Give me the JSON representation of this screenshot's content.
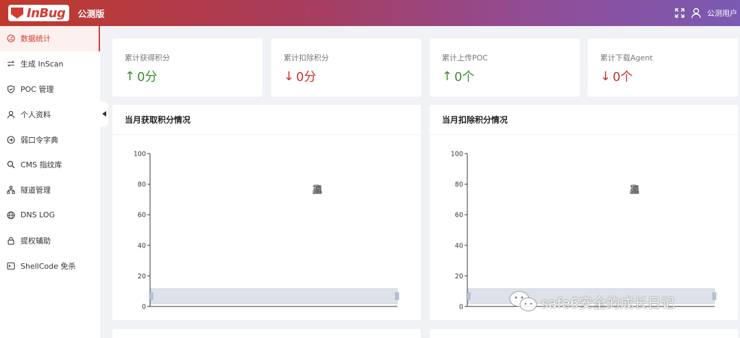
{
  "header": {
    "logo_text": "InBug",
    "edition": "公测版",
    "user_name": "公测用户",
    "icons": [
      "fullscreen-icon",
      "user-icon"
    ]
  },
  "sidebar": {
    "items": [
      {
        "label": "数据统计",
        "icon": "dashboard-icon",
        "active": true
      },
      {
        "label": "生成 InScan",
        "icon": "swap-icon"
      },
      {
        "label": "POC 管理",
        "icon": "shield-icon"
      },
      {
        "label": "个人资料",
        "icon": "user-icon"
      },
      {
        "label": "弱口令字典",
        "icon": "login-icon"
      },
      {
        "label": "CMS 指纹库",
        "icon": "search-icon"
      },
      {
        "label": "隧道管理",
        "icon": "tree-icon"
      },
      {
        "label": "DNS LOG",
        "icon": "globe-icon"
      },
      {
        "label": "提权辅助",
        "icon": "lock-icon"
      },
      {
        "label": "ShellCode 免杀",
        "icon": "terminal-icon"
      }
    ]
  },
  "stats": [
    {
      "label": "累计获得积分",
      "arrow": "↑",
      "value": "0分",
      "direction": "up"
    },
    {
      "label": "累计扣除积分",
      "arrow": "↓",
      "value": "0分",
      "direction": "down"
    },
    {
      "label": "累计上传POC",
      "arrow": "↑",
      "value": "0个",
      "direction": "up"
    },
    {
      "label": "累计下载Agent",
      "arrow": "↓",
      "value": "0个",
      "direction": "down"
    }
  ],
  "panels": [
    {
      "title": "当月获取积分情况"
    },
    {
      "title": "当月扣除积分情况"
    }
  ],
  "chart_data": [
    {
      "type": "bar",
      "title": "",
      "categories": [],
      "series": [],
      "ylim": [
        0,
        100
      ],
      "yticks": [
        "100",
        "80",
        "60",
        "40",
        "20",
        "0"
      ],
      "grid": false,
      "toolbox": [
        "data-view-icon",
        "restore-icon",
        "zoom-icon",
        "zoom-reset-icon",
        "download-icon",
        "bar-switch-icon",
        "line-switch-icon"
      ],
      "datazoom": true
    },
    {
      "type": "bar",
      "title": "",
      "categories": [],
      "series": [],
      "ylim": [
        0,
        100
      ],
      "yticks": [
        "100",
        "80",
        "60",
        "40",
        "20",
        "0"
      ],
      "grid": false,
      "toolbox": [
        "data-view-icon",
        "restore-icon",
        "zoom-icon",
        "zoom-reset-icon",
        "download-icon",
        "bar-switch-icon",
        "line-switch-icon"
      ],
      "datazoom": true
    }
  ],
  "watermark": {
    "text": "safe6安全的成长日记"
  },
  "colors": {
    "accent": "#d63a2f",
    "up": "#3c8a2e",
    "down": "#c9302c"
  }
}
